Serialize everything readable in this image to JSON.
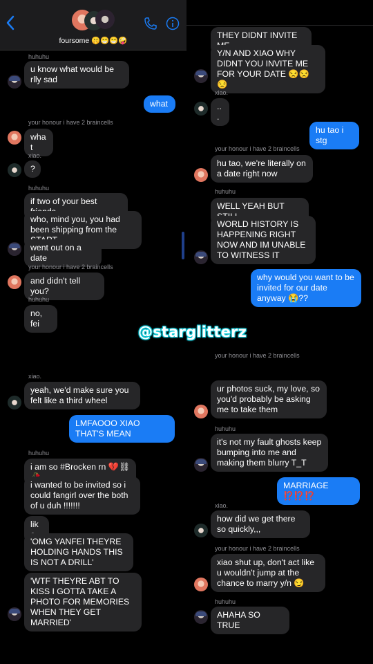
{
  "header": {
    "back_icon": "chevron-left-icon",
    "group_name": "foursome 🤫😁😁🤪",
    "phone_icon": "phone-icon",
    "info_icon": "info-icon"
  },
  "watermark": "@starglitterz",
  "senders": {
    "huhuhu": "huhuhu",
    "yanfei": "your honour i have 2 braincells",
    "xiao": "xiao."
  },
  "panel1": {
    "m1": "u know what would be rlly sad",
    "m2": "what",
    "m3": "what",
    "m4": "?",
    "m5": "if two of your best friends",
    "m6": "who, mind you, you had been shipping from the START",
    "m7": "went out on a date",
    "m8": "and didn't tell you?",
    "m9": "no, fei"
  },
  "panel2": {
    "m1": "THEY DIDNT INVITE ME",
    "m2": "Y/N AND XIAO WHY DIDNT YOU INVITE ME FOR YOUR DATE 😒😒😒",
    "m3": "...",
    "m4": "hu tao i stg",
    "m5": "hu tao, we're literally on a date right now",
    "m6": "WELL YEAH BUT STILL",
    "m7": "WORLD HISTORY IS HAPPENING RIGHT NOW AND IM UNABLE TO WITNESS IT",
    "m8": "why would you want to be invited for our date anyway 😭??"
  },
  "panel3": {
    "m1": "yeah, we'd make sure you felt like a third wheel",
    "m2": "LMFAOOO XIAO THAT'S MEAN",
    "m3": "i am so #Brocken rn 💔⛓🥀",
    "m4": "i wanted to be invited so i could fangirl over the both of u duh !!!!!!!",
    "m5": "like",
    "m6": "'OMG YANFEI THEYRE HOLDING HANDS THIS IS NOT A DRILL'",
    "m7": "'WTF THEYRE ABT TO KISS I GOTTA TAKE A PHOTO FOR MEMORIES WHEN THEY GET MARRIED'"
  },
  "panel4": {
    "m1": "ur photos suck, my love, so you'd probably be asking me to take them",
    "m2": "it's not my fault ghosts keep bumping into me and making them blurry T_T",
    "m3": "MARRIAGE ⁉️⁉️⁉️",
    "m4": "how did we get there so quickly,,,",
    "m5": "xiao shut up, don't act like u wouldn't jump at the chance to marry y/n 😏",
    "m6": "AHAHA SO TRUE"
  },
  "colors": {
    "incoming": "#262628",
    "outgoing": "#1a7cf5",
    "background": "#000000",
    "watermark_glow": "#17d3e0"
  }
}
